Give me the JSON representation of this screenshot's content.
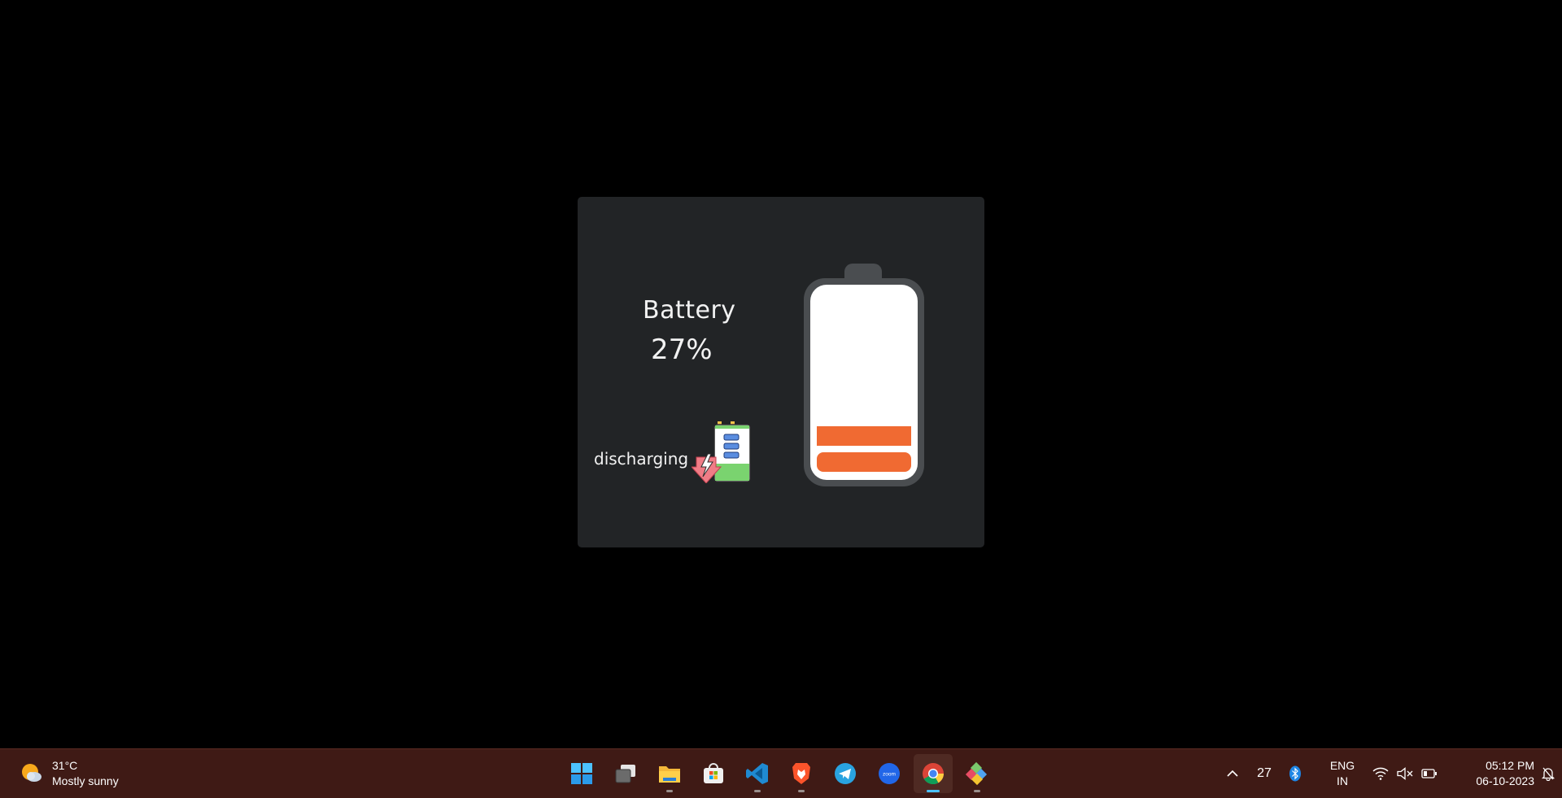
{
  "card": {
    "title": "Battery",
    "percent_label": "27%",
    "level_percent": 27,
    "status": "discharging",
    "colors": {
      "background": "#222426",
      "fill": "#f06a32",
      "body": "#ffffff",
      "frame": "#4a4d50"
    }
  },
  "taskbar": {
    "weather": {
      "temp": "31°C",
      "condition": "Mostly sunny",
      "icon": "partly-sunny-icon"
    },
    "apps": [
      {
        "name": "start",
        "icon": "windows-logo-icon",
        "running": false,
        "active": false
      },
      {
        "name": "task-view",
        "icon": "task-view-icon",
        "running": false,
        "active": false
      },
      {
        "name": "file-explorer",
        "icon": "folder-icon",
        "running": true,
        "active": false
      },
      {
        "name": "microsoft-store",
        "icon": "store-icon",
        "running": false,
        "active": false
      },
      {
        "name": "vscode",
        "icon": "vscode-icon",
        "running": true,
        "active": false
      },
      {
        "name": "brave",
        "icon": "brave-lion-icon",
        "running": true,
        "active": false
      },
      {
        "name": "telegram",
        "icon": "telegram-icon",
        "running": false,
        "active": false
      },
      {
        "name": "zoom",
        "icon": "zoom-icon",
        "running": false,
        "active": false
      },
      {
        "name": "chrome",
        "icon": "chrome-icon",
        "running": true,
        "active": true
      },
      {
        "name": "app-diamond",
        "icon": "diamond-app-icon",
        "running": true,
        "active": false
      }
    ],
    "tray": {
      "chevron": "^",
      "count": "27",
      "language": "ENG",
      "region": "IN",
      "time": "05:12 PM",
      "date": "06-10-2023"
    },
    "colors": {
      "background": "#3f1a15",
      "active_indicator": "#4cc2ff"
    }
  }
}
